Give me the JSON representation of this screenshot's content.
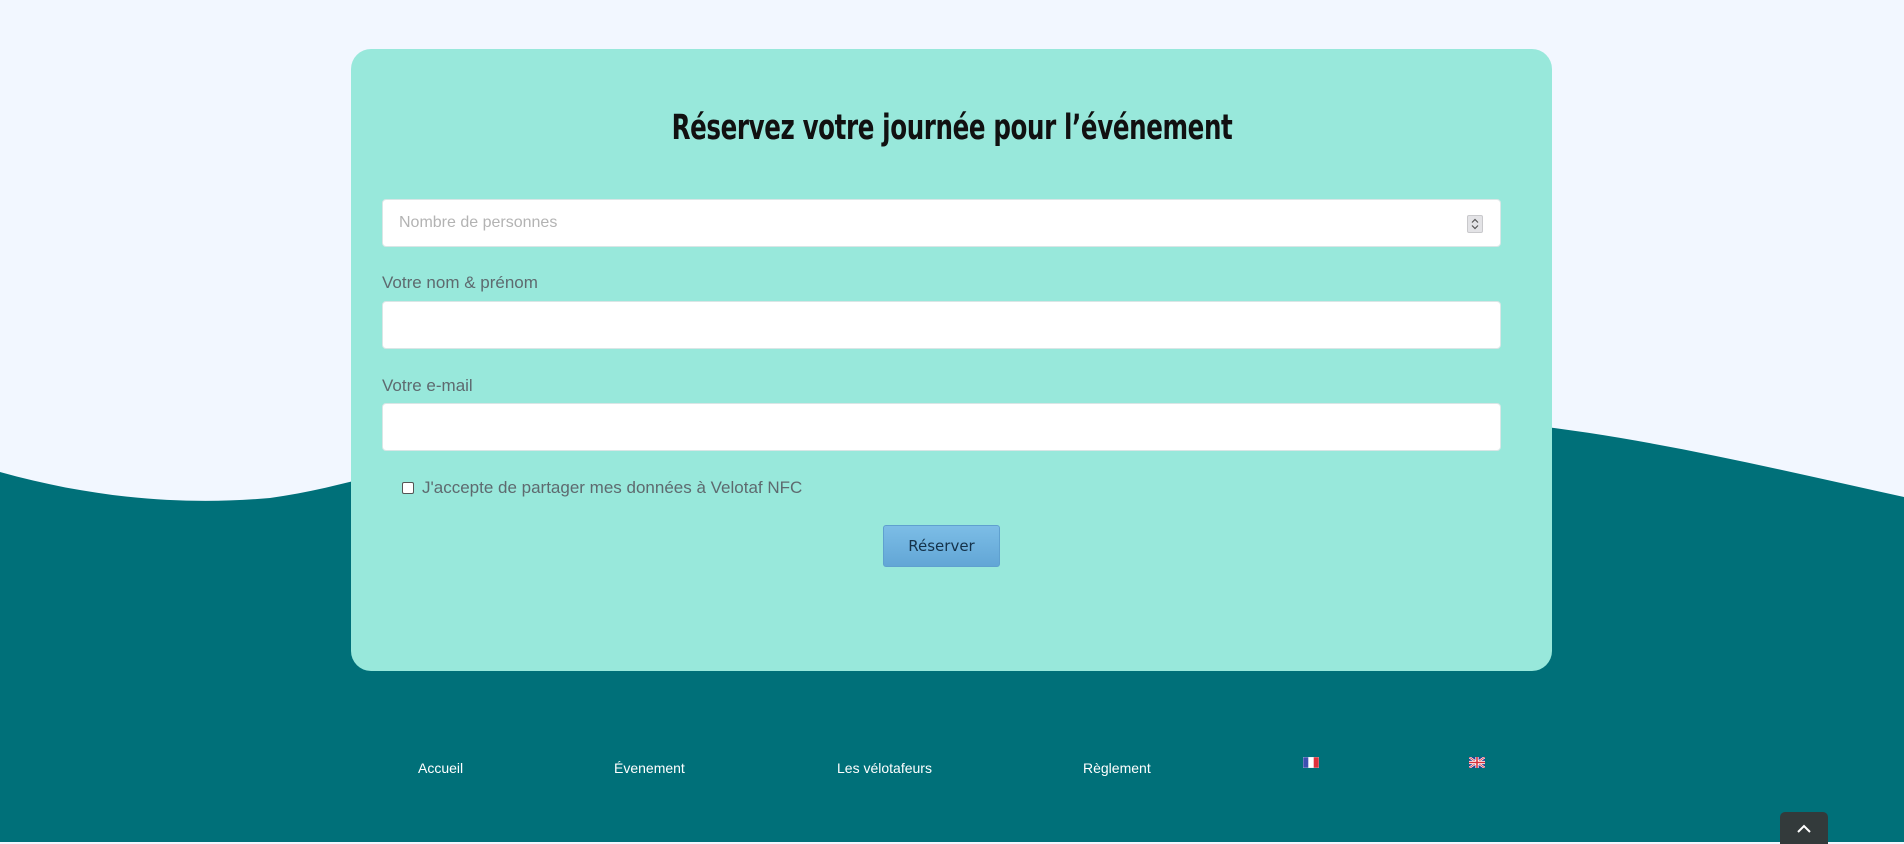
{
  "form": {
    "title": "Réservez votre journée pour l’événement",
    "people": {
      "placeholder": "Nombre de personnes",
      "value": ""
    },
    "name": {
      "label": "Votre nom & prénom",
      "value": ""
    },
    "email": {
      "label": "Votre e-mail",
      "value": ""
    },
    "consent": {
      "label": "J'accepte de partager mes données à Velotaf NFC",
      "checked": false
    },
    "submit_label": "Réserver"
  },
  "footer": {
    "links": [
      "Accueil",
      "Évenement",
      "Les vélotafeurs",
      "Règlement"
    ],
    "languages": [
      {
        "icon": "french-flag-icon"
      },
      {
        "icon": "uk-flag-icon"
      }
    ]
  },
  "scroll_top": {
    "icon": "chevron-up-icon"
  },
  "colors": {
    "page_bg": "#f2f7ff",
    "wave": "#007079",
    "card_bg": "#98e8db",
    "button": "#6fb3e0",
    "footer_text": "#ffffff"
  }
}
